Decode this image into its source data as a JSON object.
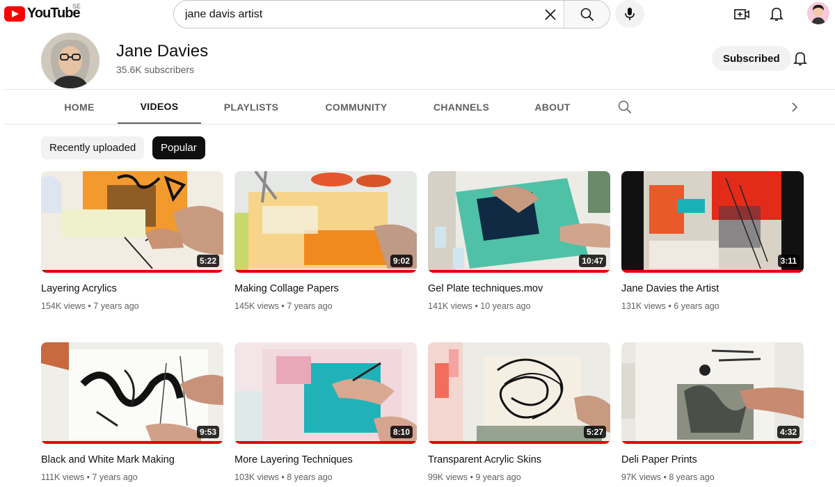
{
  "header": {
    "logo_text": "YouTube",
    "region": "SE",
    "search_value": "jane davis artist"
  },
  "channel": {
    "name": "Jane Davies",
    "subscribers": "35.6K subscribers",
    "subscribed_label": "Subscribed"
  },
  "tabs": [
    "HOME",
    "VIDEOS",
    "PLAYLISTS",
    "COMMUNITY",
    "CHANNELS",
    "ABOUT"
  ],
  "active_tab": "VIDEOS",
  "chips": [
    "Recently uploaded",
    "Popular"
  ],
  "active_chip": "Popular",
  "videos": [
    {
      "title": "Layering Acrylics",
      "views": "154K views",
      "age": "7 years ago",
      "duration": "5:22"
    },
    {
      "title": "Making Collage Papers",
      "views": "145K views",
      "age": "7 years ago",
      "duration": "9:02"
    },
    {
      "title": "Gel Plate techniques.mov",
      "views": "141K views",
      "age": "10 years ago",
      "duration": "10:47"
    },
    {
      "title": "Jane Davies the Artist",
      "views": "131K views",
      "age": "6 years ago",
      "duration": "3:11"
    },
    {
      "title": "Black and White Mark Making",
      "views": "111K views",
      "age": "7 years ago",
      "duration": "9:53"
    },
    {
      "title": "More Layering Techniques",
      "views": "103K views",
      "age": "8 years ago",
      "duration": "8:10"
    },
    {
      "title": "Transparent Acrylic Skins",
      "views": "99K views",
      "age": "9 years ago",
      "duration": "5:27"
    },
    {
      "title": "Deli Paper Prints",
      "views": "97K views",
      "age": "8 years ago",
      "duration": "4:32"
    }
  ],
  "meta_separator": "•",
  "icons": {
    "clear": "close-icon",
    "search": "search-icon",
    "mic": "microphone-icon",
    "create": "create-video-icon",
    "notifications": "bell-icon",
    "channel_bell": "bell-icon",
    "channel_search": "search-icon",
    "next": "chevron-right-icon"
  },
  "colors": {
    "brand_red": "#ff0000",
    "progress_red": "#e00000",
    "active_chip_bg": "#0f0f0f"
  }
}
